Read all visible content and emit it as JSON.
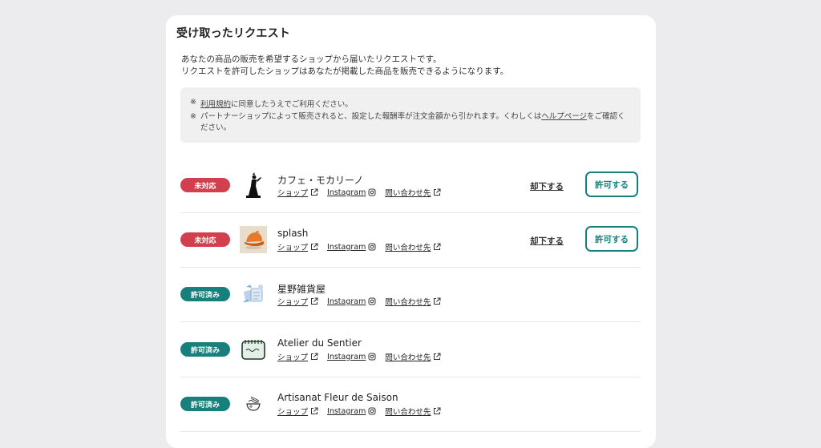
{
  "page": {
    "title": "受け取ったリクエスト",
    "description_line1": "あなたの商品の販売を希望するショップから届いたリクエストです。",
    "description_line2": "リクエストを許可したショップはあなたが掲載した商品を販売できるようになります。"
  },
  "notes": {
    "mark": "※",
    "note1_link": "利用規約",
    "note1_text": "に同意したうえでご利用ください。",
    "note2_text_before": "パートナーショップによって販売されると、設定した報酬率が注文金額から引かれます。くわしくは",
    "note2_link": "ヘルプページ",
    "note2_text_after": "をご確認ください。"
  },
  "labels": {
    "shop": "ショップ",
    "instagram": "Instagram",
    "contact": "問い合わせ先",
    "reject": "却下する",
    "approve": "許可する"
  },
  "status": {
    "pending": "未対応",
    "approved": "許可済み"
  },
  "colors": {
    "pending": "#d2404d",
    "approved": "#17807c"
  },
  "requests": [
    {
      "name": "カフェ・モカリーノ",
      "status": "未対応",
      "thumbnail": "statue-silhouette-image"
    },
    {
      "name": "splash",
      "status": "未対応",
      "thumbnail": "orange-cap-image"
    },
    {
      "name": "星野雑貨屋",
      "status": "許可済み",
      "thumbnail": "stationery-illustration"
    },
    {
      "name": "Atelier du Sentier",
      "status": "許可済み",
      "thumbnail": "notepad-illustration"
    },
    {
      "name": "Artisanat Fleur de Saison",
      "status": "許可済み",
      "thumbnail": "ramen-bowl-sketch"
    }
  ]
}
